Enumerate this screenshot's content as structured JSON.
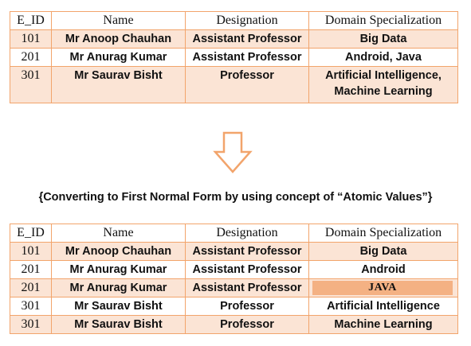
{
  "table1": {
    "headers": [
      "E_ID",
      "Name",
      "Designation",
      "Domain Specialization"
    ],
    "rows": [
      [
        "101",
        "Mr Anoop Chauhan",
        "Assistant Professor",
        "Big Data"
      ],
      [
        "201",
        "Mr Anurag Kumar",
        "Assistant Professor",
        "Android, Java"
      ],
      [
        "301",
        "Mr Saurav Bisht",
        "Professor",
        "Artificial Intelligence, Machine Learning"
      ]
    ]
  },
  "caption": "{Converting to First Normal Form by using concept of “Atomic Values”}",
  "table2": {
    "headers": [
      "E_ID",
      "Name",
      "Designation",
      "Domain Specialization"
    ],
    "rows": [
      [
        "101",
        "Mr Anoop Chauhan",
        "Assistant Professor",
        "Big Data"
      ],
      [
        "201",
        "Mr Anurag Kumar",
        "Assistant Professor",
        "Android"
      ],
      [
        "201",
        "Mr Anurag Kumar",
        "Assistant Professor",
        "JAVA"
      ],
      [
        "301",
        "Mr Saurav Bisht",
        "Professor",
        "Artificial Intelligence"
      ],
      [
        "301",
        "Mr Saurav Bisht",
        "Professor",
        "Machine Learning"
      ]
    ]
  },
  "colors": {
    "border": "#f2a46b",
    "row_shade": "#fbe4d5",
    "highlight": "#f4b183",
    "arrow": "#f2a46b"
  },
  "icons": {
    "arrow": "down-arrow-icon"
  }
}
